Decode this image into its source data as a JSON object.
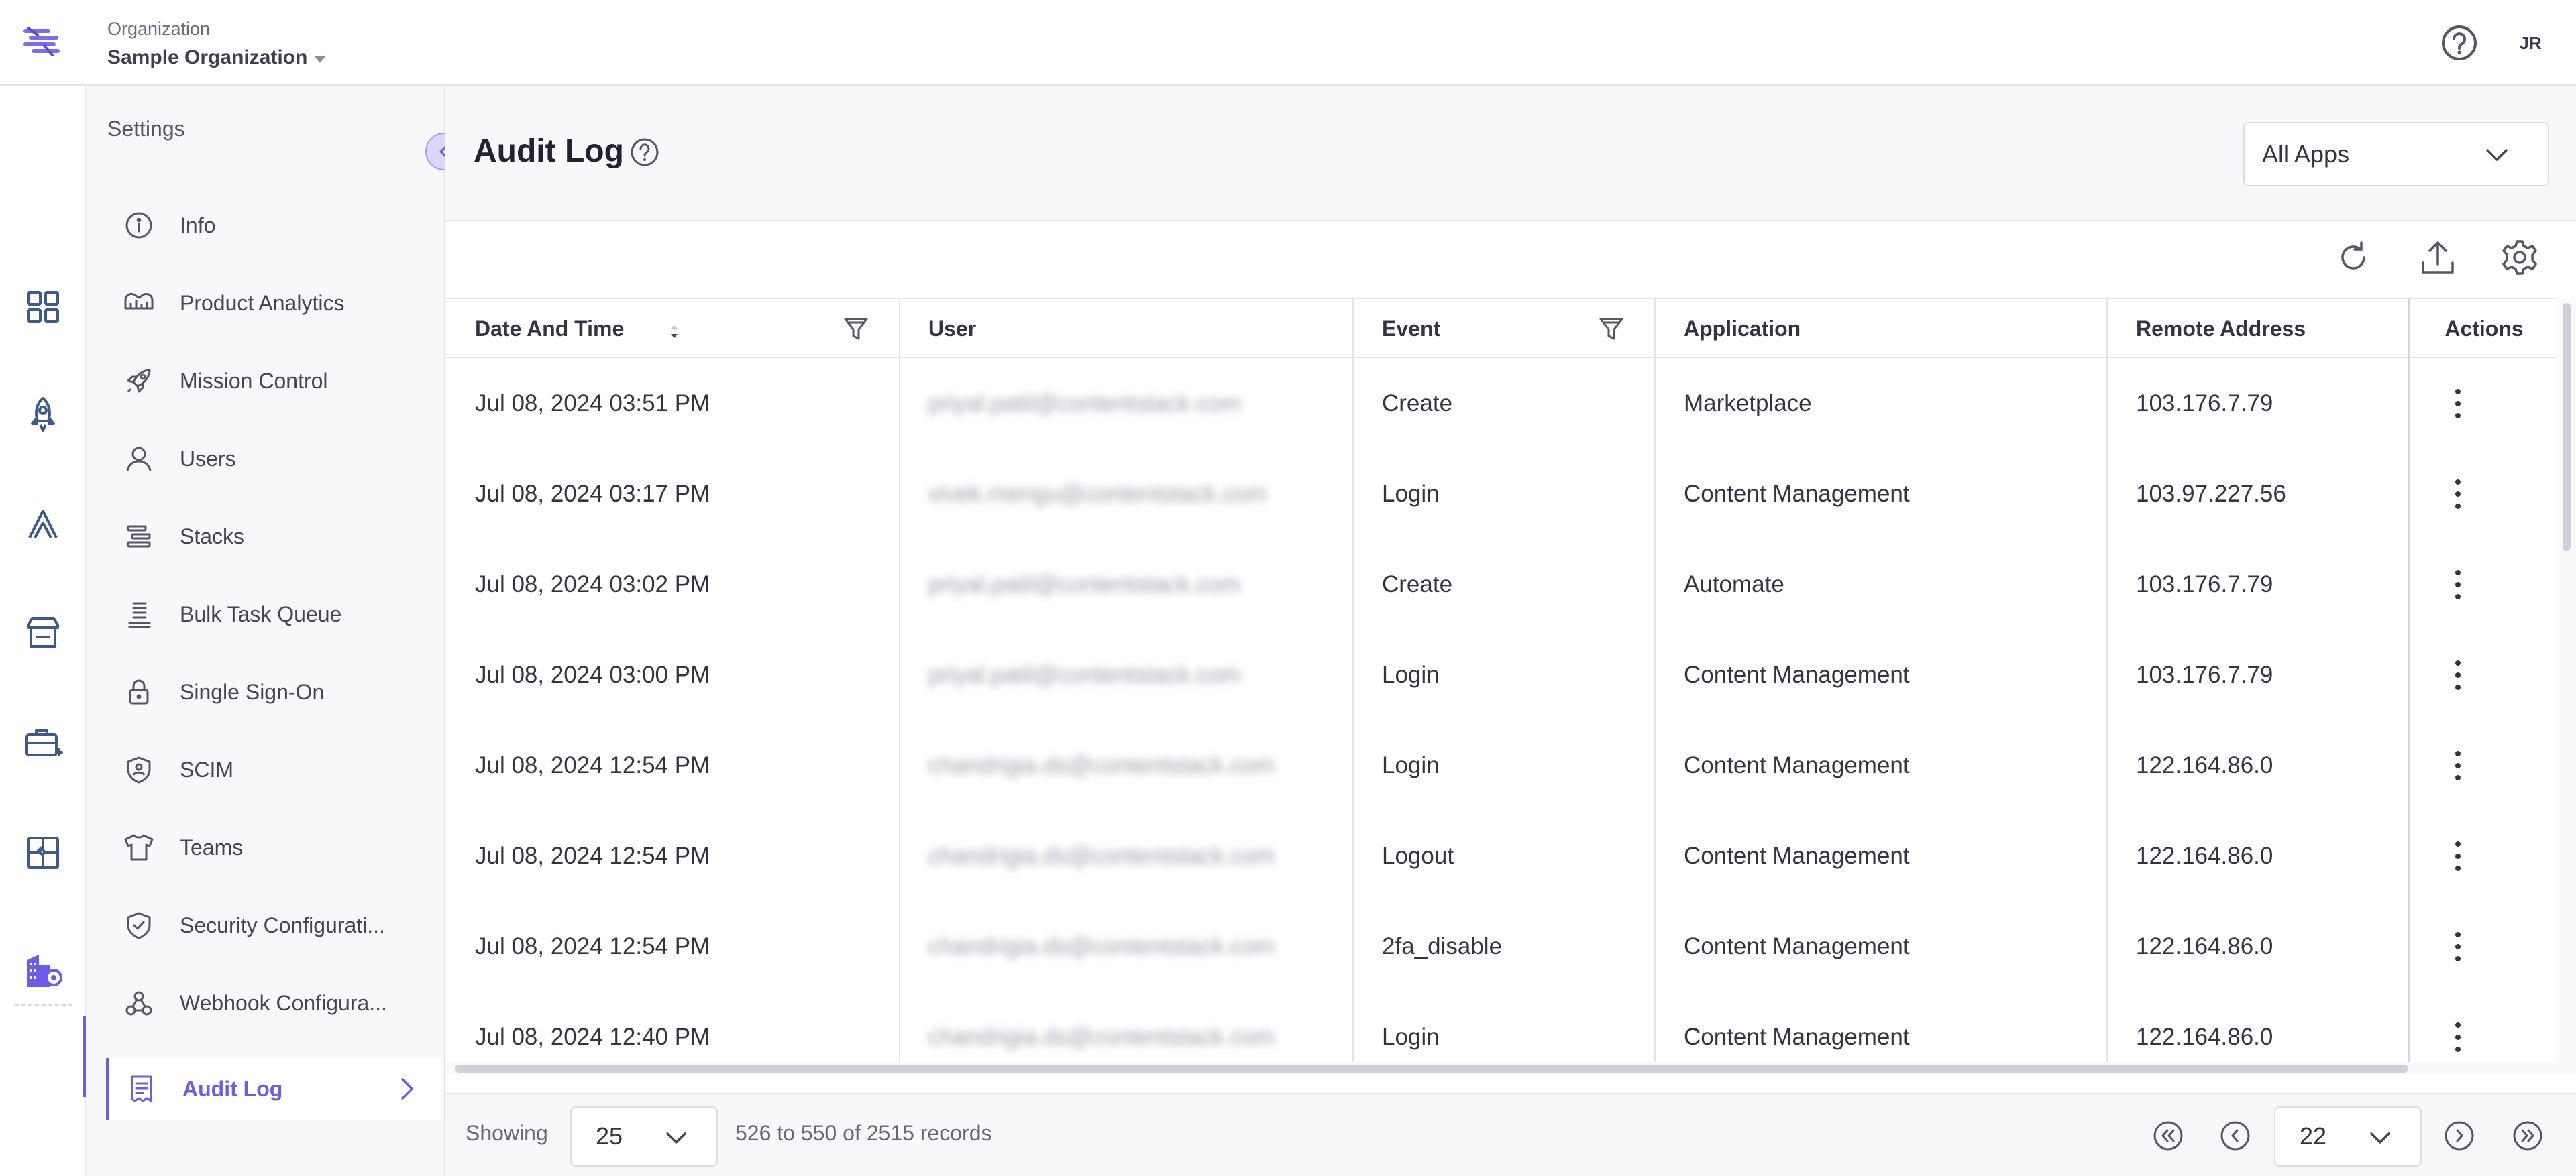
{
  "header": {
    "org_label": "Organization",
    "org_name": "Sample Organization",
    "avatar_initials": "JR"
  },
  "rail": {
    "icons": [
      "apps-grid-icon",
      "rocket-icon",
      "automate-icon",
      "marketplace-icon",
      "toolkit-icon",
      "puzzle-icon",
      "organization-icon"
    ],
    "accent_color": "#6c5ce7"
  },
  "sidebar": {
    "title": "Settings",
    "items": [
      {
        "label": "Info",
        "icon": "info-icon"
      },
      {
        "label": "Product Analytics",
        "icon": "analytics-icon"
      },
      {
        "label": "Mission Control",
        "icon": "rocket-icon"
      },
      {
        "label": "Users",
        "icon": "user-icon"
      },
      {
        "label": "Stacks",
        "icon": "stacks-icon"
      },
      {
        "label": "Bulk Task Queue",
        "icon": "queue-icon"
      },
      {
        "label": "Single Sign-On",
        "icon": "lock-icon"
      },
      {
        "label": "SCIM",
        "icon": "shield-user-icon"
      },
      {
        "label": "Teams",
        "icon": "shirt-icon"
      },
      {
        "label": "Security Configurati...",
        "icon": "shield-check-icon"
      },
      {
        "label": "Webhook Configura...",
        "icon": "webhook-icon"
      },
      {
        "label": "Audit Log",
        "icon": "document-icon",
        "active": true
      }
    ]
  },
  "main": {
    "title": "Audit Log",
    "app_filter": "All Apps",
    "columns": [
      "Date And Time",
      "User",
      "Event",
      "Application",
      "Remote Address",
      "Actions"
    ],
    "rows": [
      {
        "date": "Jul 08, 2024 03:51 PM",
        "user": "priyal.patil@contentstack.com",
        "event": "Create",
        "application": "Marketplace",
        "remote": "103.176.7.79"
      },
      {
        "date": "Jul 08, 2024 03:17 PM",
        "user": "vivek.mengu@contentstack.com",
        "event": "Login",
        "application": "Content Management",
        "remote": "103.97.227.56"
      },
      {
        "date": "Jul 08, 2024 03:02 PM",
        "user": "priyal.patil@contentstack.com",
        "event": "Create",
        "application": "Automate",
        "remote": "103.176.7.79"
      },
      {
        "date": "Jul 08, 2024 03:00 PM",
        "user": "priyal.patil@contentstack.com",
        "event": "Login",
        "application": "Content Management",
        "remote": "103.176.7.79"
      },
      {
        "date": "Jul 08, 2024 12:54 PM",
        "user": "chandrigia.ds@contentstack.com",
        "event": "Login",
        "application": "Content Management",
        "remote": "122.164.86.0"
      },
      {
        "date": "Jul 08, 2024 12:54 PM",
        "user": "chandrigia.ds@contentstack.com",
        "event": "Logout",
        "application": "Content Management",
        "remote": "122.164.86.0"
      },
      {
        "date": "Jul 08, 2024 12:54 PM",
        "user": "chandrigia.ds@contentstack.com",
        "event": "2fa_disable",
        "application": "Content Management",
        "remote": "122.164.86.0"
      },
      {
        "date": "Jul 08, 2024 12:40 PM",
        "user": "chandrigia.ds@contentstack.com",
        "event": "Login",
        "application": "Content Management",
        "remote": "122.164.86.0"
      }
    ]
  },
  "footer": {
    "showing_label": "Showing",
    "per_page": "25",
    "records_text": "526 to 550 of 2515 records",
    "current_page": "22"
  }
}
